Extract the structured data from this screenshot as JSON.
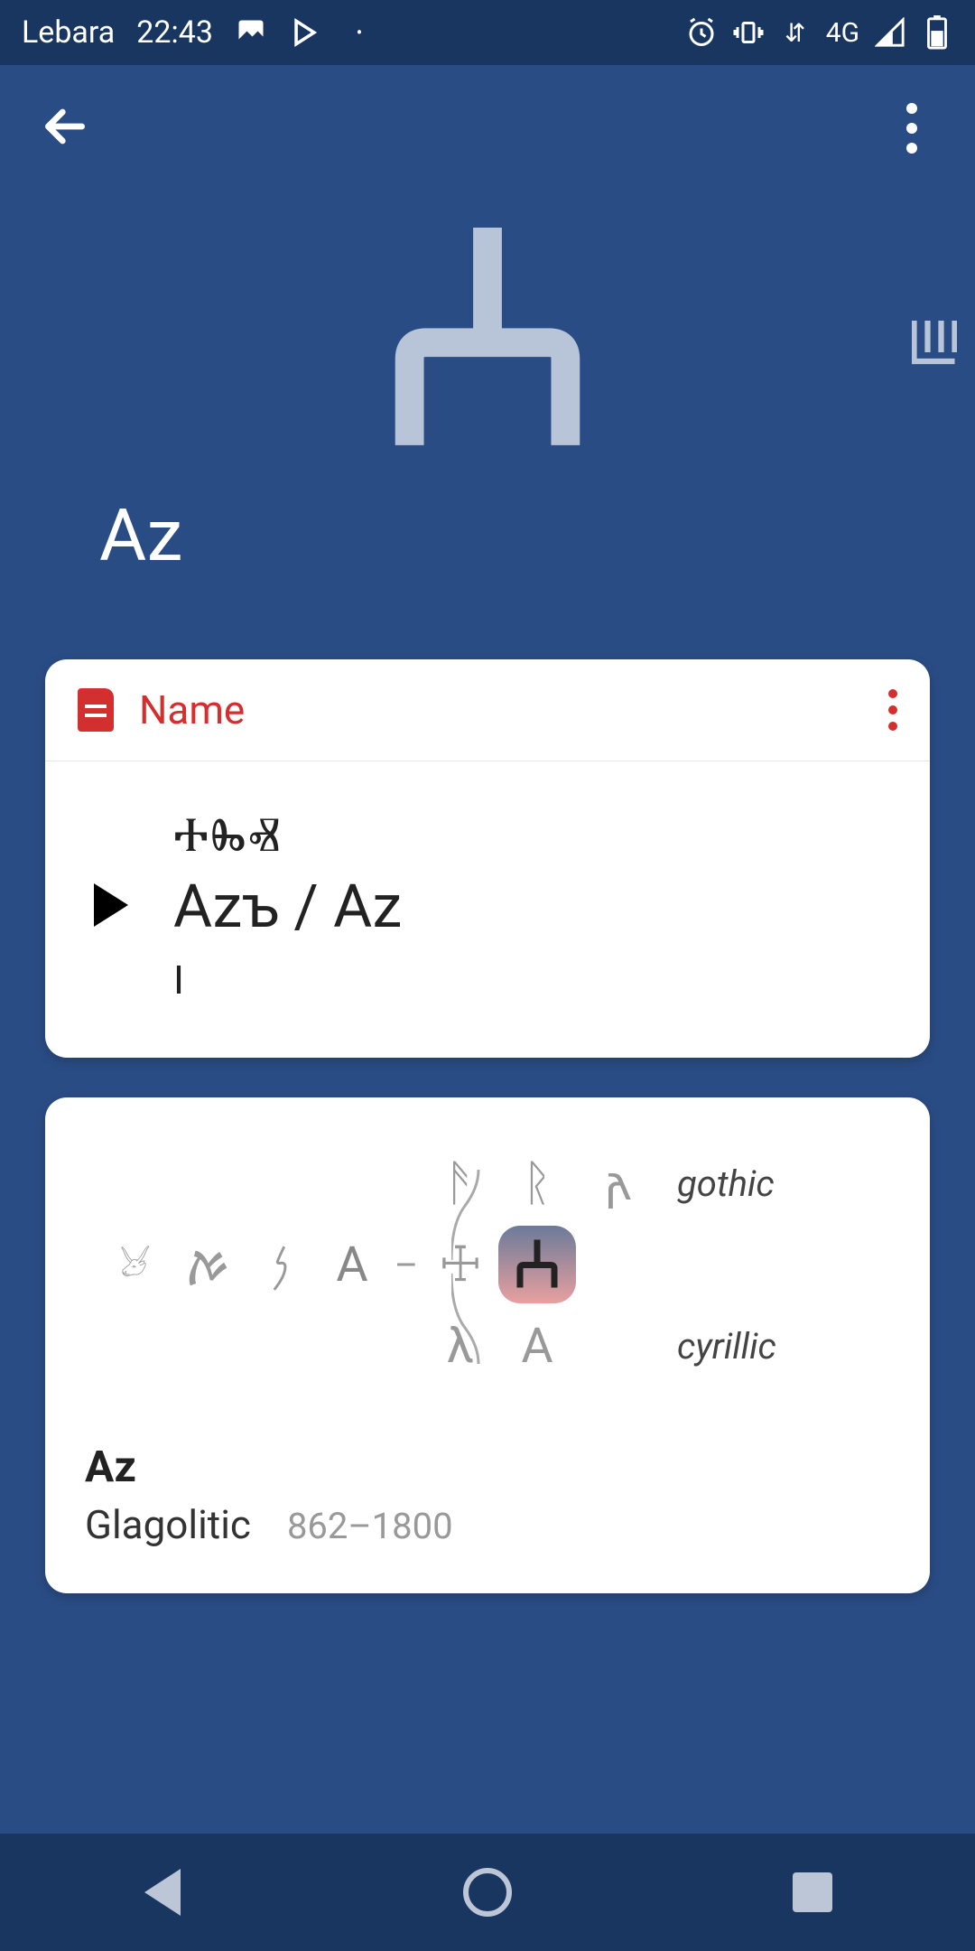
{
  "status": {
    "carrier": "Lebara",
    "time": "22:43",
    "network": "4G"
  },
  "hero": {
    "glyph": "Ⰰ",
    "title": "Az",
    "side_glyph": "Ⱎ"
  },
  "name_card": {
    "header": "Name",
    "glagolitic": "ⰀⰈⰟ",
    "latin": "Azъ / Az",
    "sub": "I"
  },
  "evolution": {
    "rows": {
      "top": {
        "g1": "ᚫ",
        "g2": "ᚱ",
        "g3": "𐌰",
        "label": "gothic"
      },
      "mid": {
        "ox": "𓃾",
        "g1": "ࠀ",
        "g2": "𐤍",
        "g3": "А",
        "dash": "–",
        "cross": "☩",
        "highlight": "Ⰰ"
      },
      "bot": {
        "g1": "λ",
        "g2": "А",
        "label": "cyrillic"
      }
    },
    "footer": {
      "name": "Az",
      "script": "Glagolitic",
      "dates": "862–1800"
    }
  }
}
